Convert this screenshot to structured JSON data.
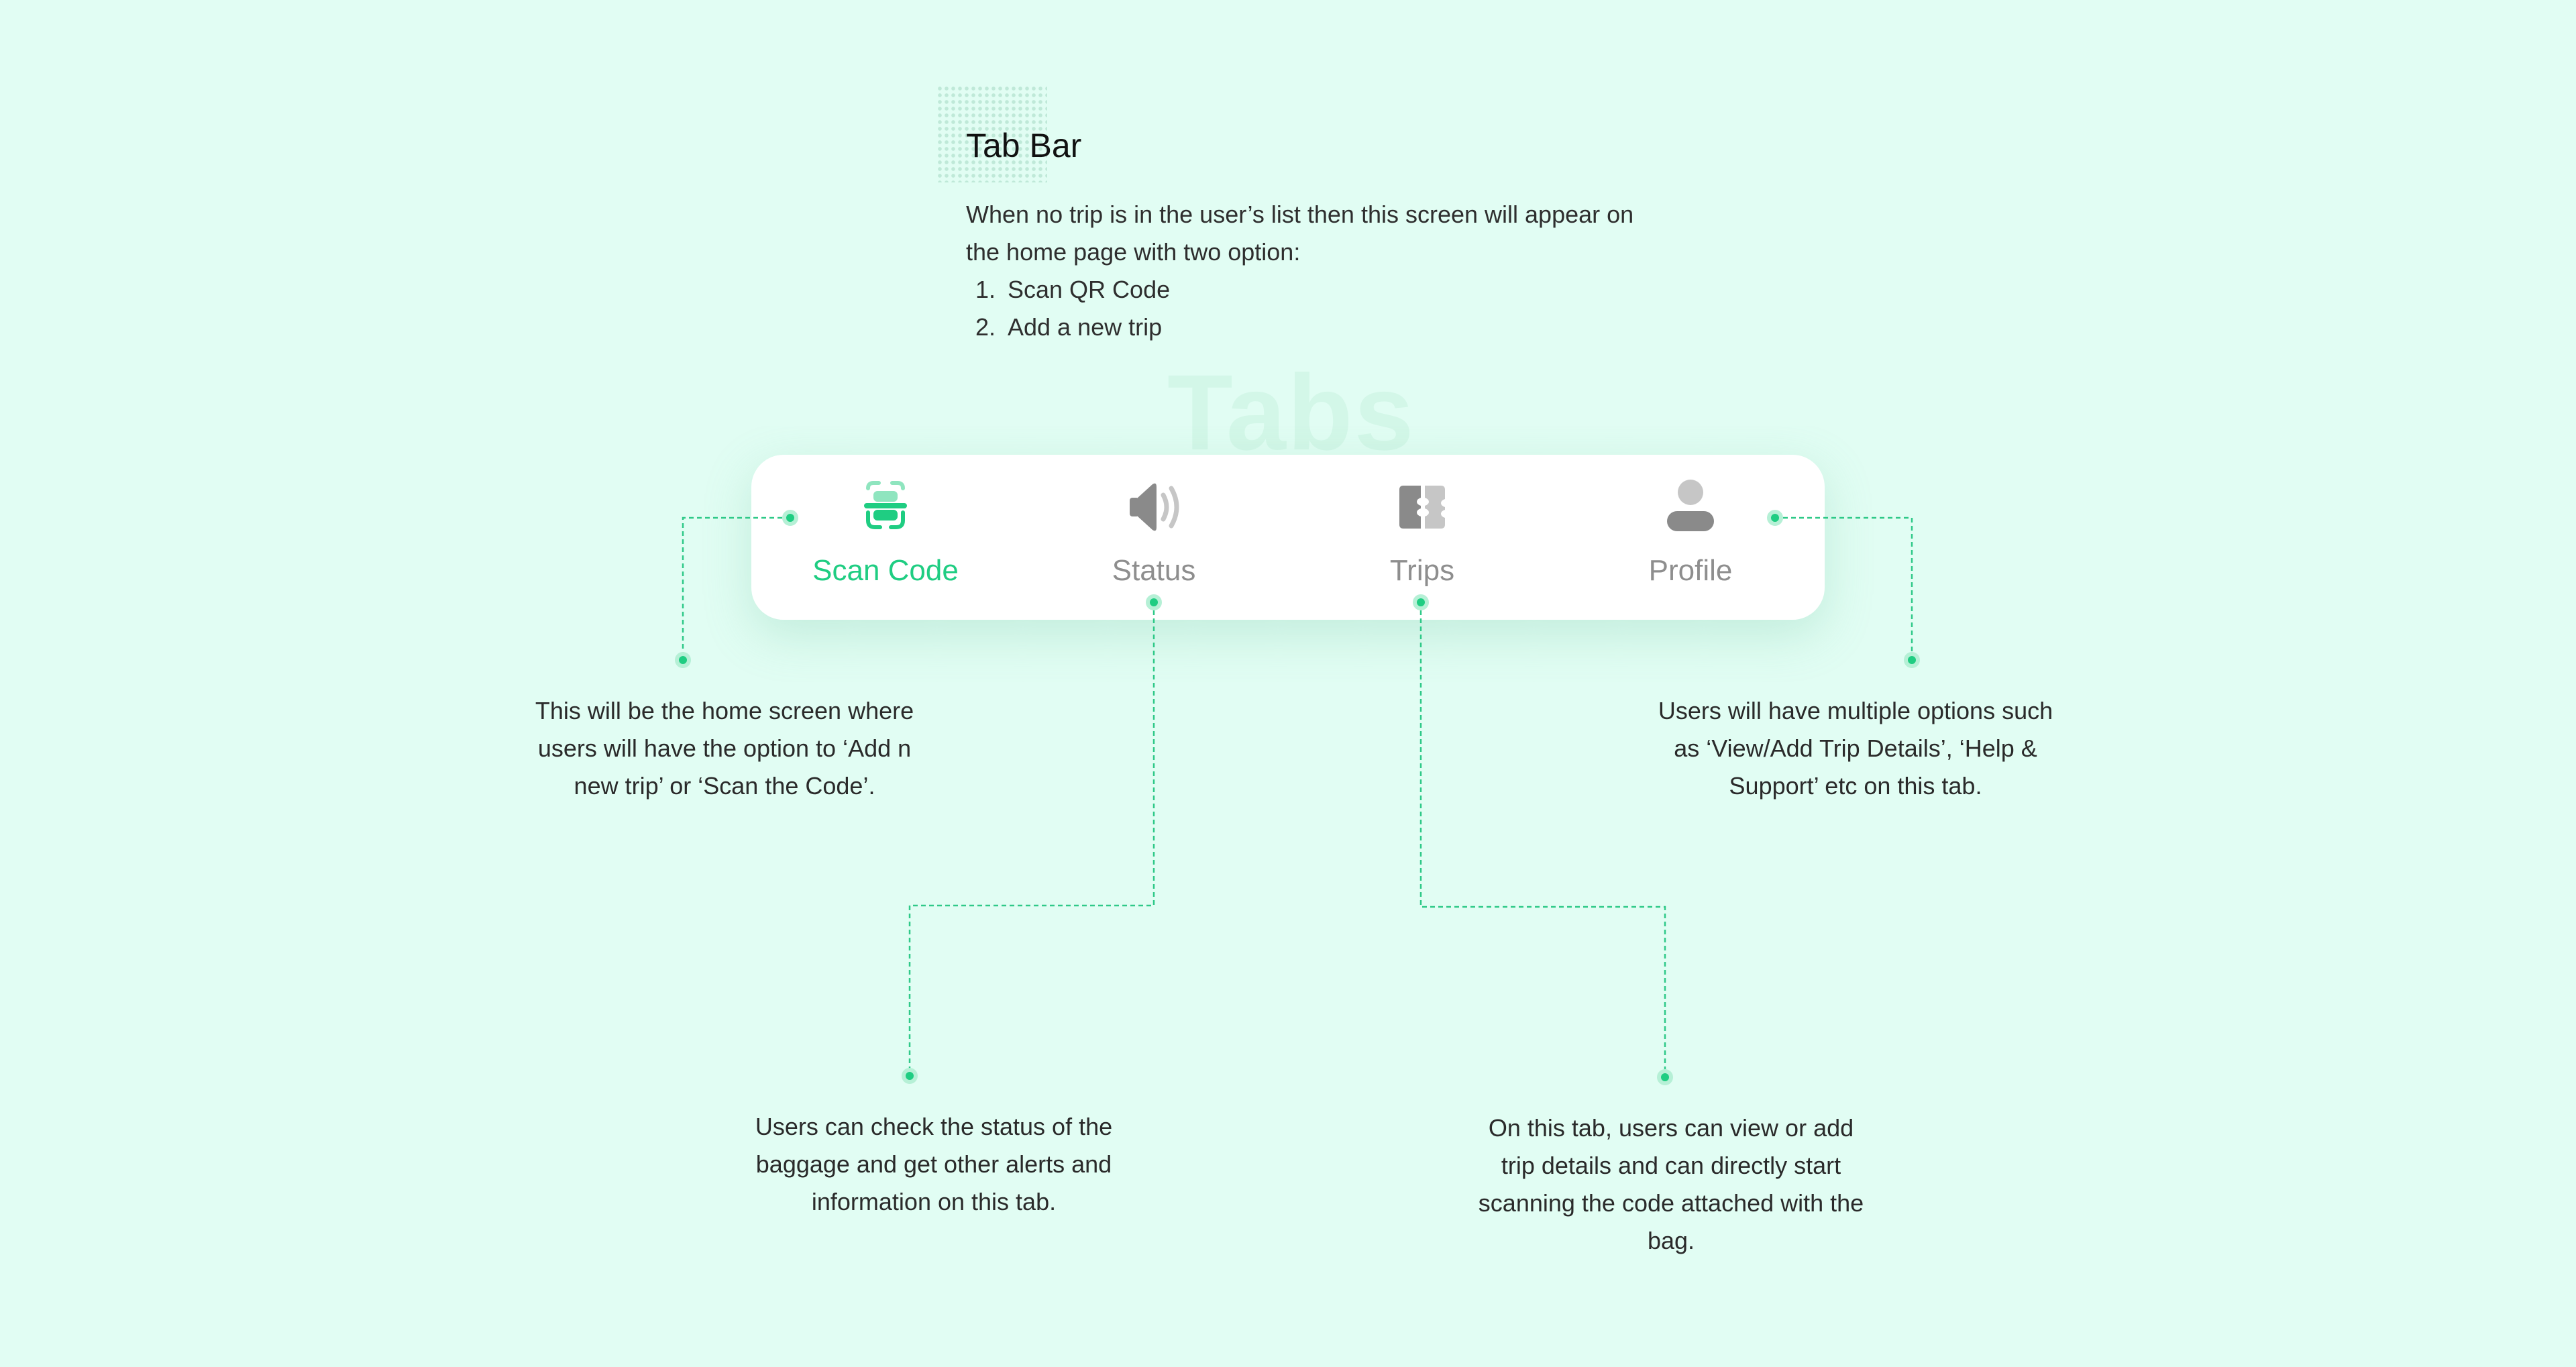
{
  "header": {
    "title": "Tab Bar",
    "description": "When no trip is in the user’s list then this screen will appear on the home page with two option:",
    "options": [
      "Scan QR Code",
      "Add a new trip"
    ]
  },
  "watermark": "Tabs",
  "tabbar": {
    "tabs": [
      {
        "label": "Scan Code",
        "icon": "scan-code-icon",
        "active": true
      },
      {
        "label": "Status",
        "icon": "speaker-icon",
        "active": false
      },
      {
        "label": "Trips",
        "icon": "ticket-icon",
        "active": false
      },
      {
        "label": "Profile",
        "icon": "user-icon",
        "active": false
      }
    ]
  },
  "annotations": [
    {
      "tab": "Scan Code",
      "text": "This will be the home screen where users will have the option to ‘Add n new trip’ or ‘Scan the Code’."
    },
    {
      "tab": "Status",
      "text": "Users can check the status of the baggage and get other alerts and information on this tab."
    },
    {
      "tab": "Trips",
      "text": "On this tab, users can view or add trip details and can directly start scanning the code attached with the bag."
    },
    {
      "tab": "Profile",
      "text": "Users will have multiple options such as ‘View/Add Trip Details’, ‘Help & Support’ etc on this tab."
    }
  ],
  "colors": {
    "background": "#e1fdf3",
    "accent": "#1fcd82",
    "inactive": "#8e8e8e",
    "connector": "#2fc988"
  }
}
